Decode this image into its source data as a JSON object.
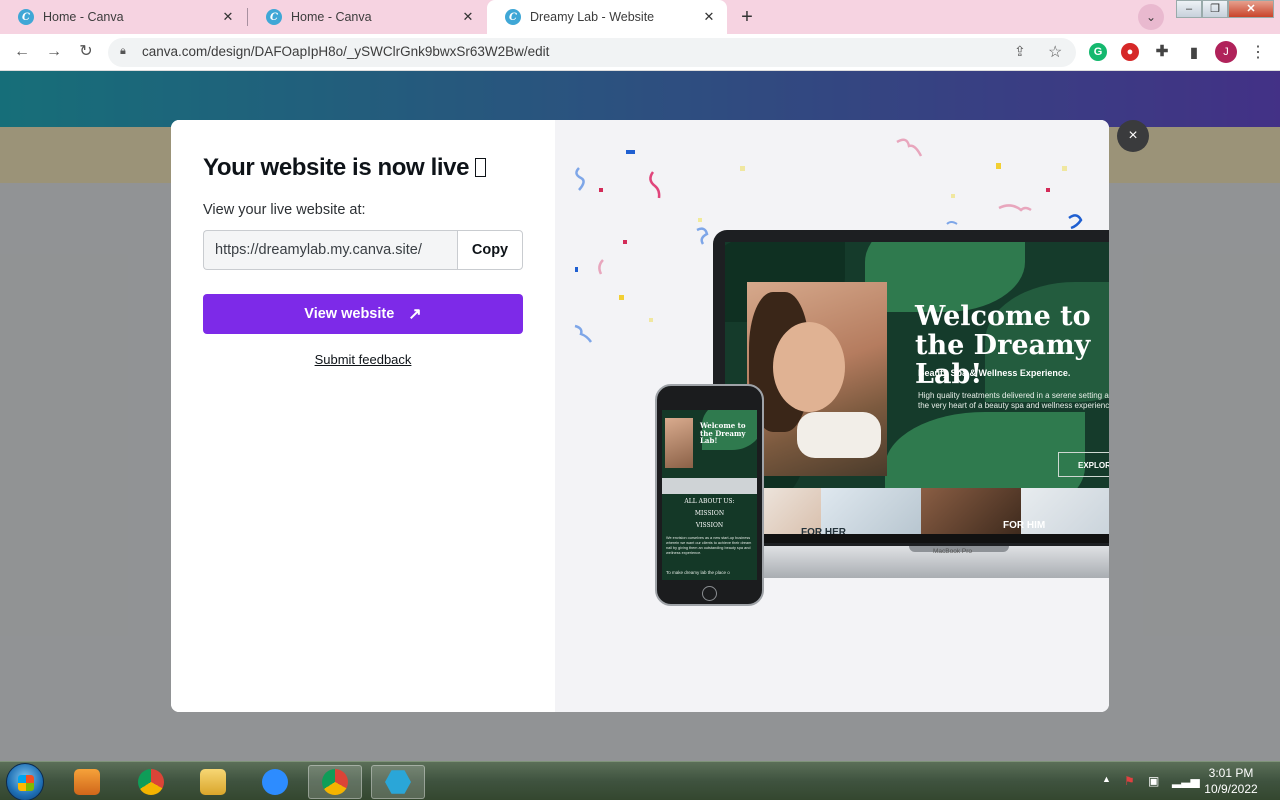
{
  "browser": {
    "tabs": [
      {
        "title": "Home - Canva",
        "active": false
      },
      {
        "title": "Home - Canva",
        "active": false
      },
      {
        "title": "Dreamy Lab - Website",
        "active": true
      }
    ],
    "address": "canva.com/design/DAFOapIpH8o/_ySWClrGnk9bwxSr63W2Bw/edit",
    "profile_initial": "J",
    "new_tab_glyph": "+",
    "menu_glyph": "⋮"
  },
  "modal": {
    "title": "Your website is now live ",
    "subtitle": "View your live website at:",
    "site_url": "https://dreamylab.my.canva.site/",
    "copy_label": "Copy",
    "view_label": "View website",
    "feedback_label": "Submit feedback",
    "close_glyph": "×"
  },
  "preview": {
    "laptop": {
      "heading": "Welcome to the Dreamy Lab!",
      "tagline": "Beauty Spa & Wellness Experience.",
      "description": "High quality treatments delivered in a serene setting are the very heart of a beauty spa and wellness experience.",
      "cta": "EXPLORE",
      "for_her": "FOR HER",
      "for_him": "FOR HIM",
      "brand": "MacBook Pro"
    },
    "phone": {
      "heading": "Welcome to the Dreamy Lab!",
      "about_lines": [
        "ALL ABOUT US:",
        "MISSION",
        "VISSION"
      ],
      "body": "We envision ourselves as a new start-up business wherein we want our clients to achieve their dream nail by giving them an outstanding beauty spa and wellness experience.",
      "footer": "To make dreamy lab the place o"
    }
  },
  "taskbar": {
    "apps": [
      "windows-media-player",
      "google-chrome",
      "file-explorer",
      "zoom",
      "google-chrome-profile",
      "app-hex"
    ],
    "time": "3:01 PM",
    "date": "10/9/2022"
  },
  "colors": {
    "accent_purple": "#7d2ae8",
    "tab_strip": "#f6d3e1"
  }
}
